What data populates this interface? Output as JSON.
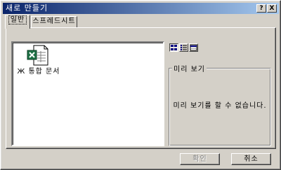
{
  "dialog": {
    "title": "새로 만들기",
    "title_buttons": {
      "help": "?",
      "close": "X"
    }
  },
  "tabs": [
    {
      "label": "일반",
      "active": true
    },
    {
      "label": "스프레드시트",
      "active": false
    }
  ],
  "file_list": {
    "items": [
      {
        "label": "Ж 통합 문서",
        "icon": "excel-workbook-icon"
      }
    ]
  },
  "view_buttons": [
    {
      "icon": "large-icons-view-icon",
      "pressed": true
    },
    {
      "icon": "list-view-icon",
      "pressed": false
    },
    {
      "icon": "details-view-icon",
      "pressed": false
    }
  ],
  "preview": {
    "label": "미리 보기",
    "message": "미리 보기를 할 수 없습니다."
  },
  "buttons": {
    "ok": "확인",
    "cancel": "취소"
  }
}
